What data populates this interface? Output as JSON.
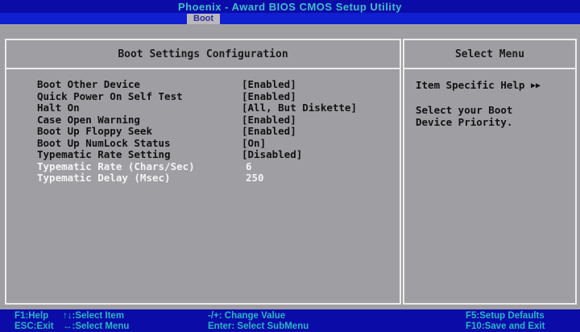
{
  "app_title": "Phoenix - Award BIOS CMOS Setup Utility",
  "menubar": {
    "active_tab": "Boot"
  },
  "main_panel": {
    "header": "Boot Settings Configuration",
    "rows": [
      {
        "label": "Boot Other Device",
        "value": "[Enabled]",
        "highlight": false
      },
      {
        "label": "Quick Power On Self Test",
        "value": "[Enabled]",
        "highlight": false
      },
      {
        "label": "Halt On",
        "value": "[All, But Diskette]",
        "highlight": false
      },
      {
        "label": "Case Open Warning",
        "value": "[Enabled]",
        "highlight": false
      },
      {
        "label": "Boot Up Floppy Seek",
        "value": "[Enabled]",
        "highlight": false
      },
      {
        "label": "Boot Up NumLock Status",
        "value": "[On]",
        "highlight": false
      },
      {
        "label": "Typematic Rate Setting",
        "value": "[Disabled]",
        "highlight": false
      },
      {
        "label": "Typematic Rate (Chars/Sec)",
        "value": "6",
        "highlight": true
      },
      {
        "label": "Typematic Delay (Msec)",
        "value": "250",
        "highlight": true
      }
    ]
  },
  "help_panel": {
    "header": "Select Menu",
    "title": "Item Specific Help",
    "title_icon": "double-arrow-right-icon",
    "text": "Select your Boot\nDevice Priority."
  },
  "footer": {
    "f1": "F1:Help",
    "esc": "ESC:Exit",
    "select_item": "↑↓:Select Item",
    "select_menu": "↔:Select Menu",
    "change_value": "-/+: Change Value",
    "enter": "Enter: Select SubMenu",
    "f5": "F5:Setup Defaults",
    "f10": "F10:Save and Exit"
  },
  "colors": {
    "background": "#9f9fa3",
    "bar_blue": "#0b0ba8",
    "hint_cyan": "#26b8c4",
    "highlight_text": "#f4f4f4"
  }
}
